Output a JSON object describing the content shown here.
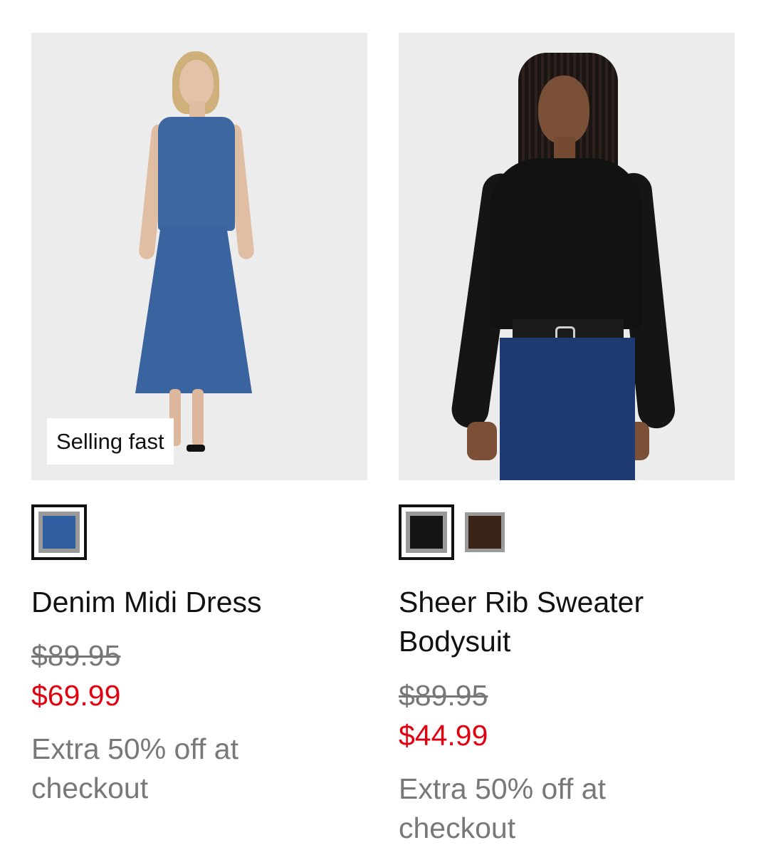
{
  "products": [
    {
      "name": "Denim Midi Dress",
      "badge": "Selling fast",
      "original_price": "$89.95",
      "sale_price": "$69.99",
      "promo": "Extra 50% off at checkout",
      "swatches": [
        {
          "color": "#2f5fa0",
          "selected": true
        }
      ]
    },
    {
      "name": "Sheer Rib Sweater Bodysuit",
      "original_price": "$89.95",
      "sale_price": "$44.99",
      "promo": "Extra 50% off at checkout",
      "swatches": [
        {
          "color": "#141414",
          "selected": true
        },
        {
          "color": "#3b2417",
          "selected": false
        }
      ]
    }
  ],
  "colors": {
    "sale": "#e10010",
    "original": "#777777",
    "promo": "#787878",
    "image_bg": "#ececed"
  }
}
